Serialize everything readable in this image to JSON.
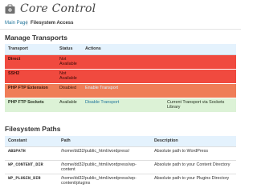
{
  "app": {
    "title": "Core Control",
    "icon": "gear-toolbox-icon"
  },
  "tabs": {
    "main_label": "Main Page",
    "separator": "|",
    "active_label": "Filesystem Access"
  },
  "transports": {
    "heading": "Manage Transports",
    "columns": [
      "Transport",
      "Status",
      "Actions",
      ""
    ],
    "rows": [
      {
        "name": "Direct",
        "status": "Not Available",
        "action": "",
        "note": "",
        "color": "#f04a3f"
      },
      {
        "name": "SSH2",
        "status": "Not Available",
        "action": "",
        "note": "",
        "color": "#f04a3f"
      },
      {
        "name": "PHP FTP Extension",
        "status": "Disabled",
        "action": "Enable Transport",
        "note": "",
        "color": "#ef7d57"
      },
      {
        "name": "PHP FTP Sockets",
        "status": "Available",
        "action": "Disable Transport",
        "note": "Current Transport via Sockets Library",
        "color": "#dcf2d6"
      }
    ]
  },
  "paths": {
    "heading": "Filesystem Paths",
    "columns": [
      "Constant",
      "Path",
      "Description"
    ],
    "rows": [
      {
        "constant": "ABSPATH",
        "path": "/home/dd32/public_html/wordpress/",
        "description": "Absolute path to WordPress"
      },
      {
        "constant": "WP_CONTENT_DIR",
        "path": "/home/dd32/public_html/wordpress/wp-content",
        "description": "Absolute path to your Content Directory"
      },
      {
        "constant": "WP_PLUGIN_DIR",
        "path": "/home/dd32/public_html/wordpress/wp-content/plugins",
        "description": "Absolute path to your Plugins Directory"
      }
    ]
  }
}
